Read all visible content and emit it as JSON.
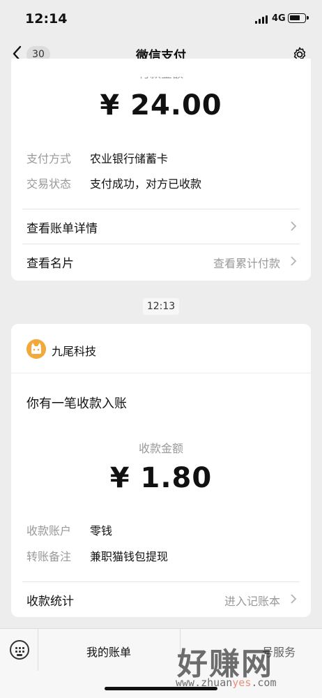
{
  "status_bar": {
    "time": "12:14",
    "network": "4G"
  },
  "nav": {
    "unread_count": "30",
    "title": "微信支付"
  },
  "payment": {
    "amount_label": "付款金额",
    "amount": "¥ 24.00",
    "rows": [
      {
        "label": "支付方式",
        "value": "农业银行储蓄卡"
      },
      {
        "label": "交易状态",
        "value": "支付成功，对方已收款"
      }
    ],
    "bill_detail_link": "查看账单详情",
    "card_link": "查看名片",
    "cumulative_link": "查看累计付款"
  },
  "timestamp": "12:13",
  "receipt": {
    "merchant_name": "九尾科技",
    "notice": "你有一笔收款入账",
    "amount_label": "收款金额",
    "amount": "¥ 1.80",
    "rows": [
      {
        "label": "收款账户",
        "value": "零钱"
      },
      {
        "label": "转账备注",
        "value": "兼职猫钱包提现"
      }
    ],
    "stats_link": "收款统计",
    "ledger_link": "进入记账本"
  },
  "toolbar": {
    "my_bills": "我的账单",
    "other": "号服务"
  },
  "watermark": {
    "big": "好赚网",
    "small_pre": "www.zhuan",
    "small_accent": "yes",
    "small_post": ".com"
  },
  "colors": {
    "background": "#ededed",
    "card": "#ffffff",
    "muted": "#999999",
    "logo": "#f2a93b"
  }
}
